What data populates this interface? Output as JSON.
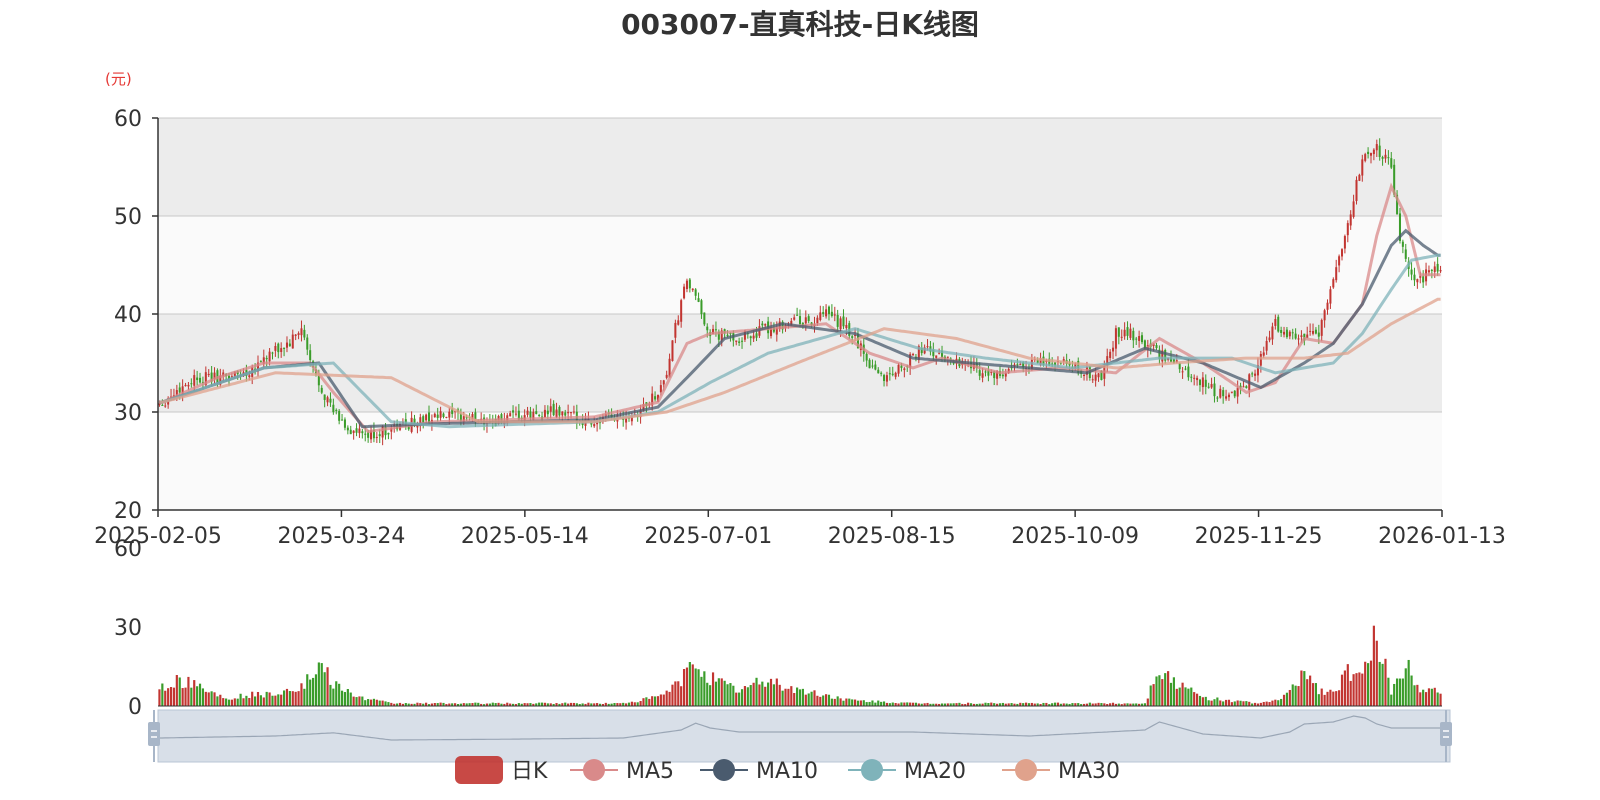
{
  "chart_data": {
    "type": "candlestick",
    "title": "003007-直真科技-日K线图",
    "unit_label": "(元)",
    "price_axis": {
      "ylim": [
        20,
        60
      ],
      "ticks": [
        "20",
        "30",
        "40",
        "50",
        "60"
      ]
    },
    "volume_axis": {
      "ylim": [
        0,
        60
      ],
      "ticks": [
        "0",
        "30",
        "60"
      ]
    },
    "x_ticks": [
      "2025-02-05",
      "2025-03-24",
      "2025-05-14",
      "2025-07-01",
      "2025-08-15",
      "2025-10-09",
      "2025-11-25",
      "2026-01-13"
    ],
    "legend": [
      "日K",
      "MA5",
      "MA10",
      "MA20",
      "MA30"
    ],
    "colors": {
      "up": "#c23531",
      "down": "#3a9c2a",
      "ma5": "#d98a8a",
      "ma10": "#4a5b6e",
      "ma20": "#7fb3ba",
      "ma30": "#e0a28c",
      "grid_band_dark": "#ececec",
      "grid_band_light": "#fafafa",
      "slider_bg": "#d8dfe8"
    },
    "price_path_x": [
      1,
      12,
      20,
      30,
      36,
      45,
      49,
      52,
      55,
      60,
      66,
      72,
      82,
      95,
      105,
      115,
      125,
      135,
      150,
      165,
      172,
      175,
      178,
      182,
      190,
      200,
      210,
      220,
      225,
      230,
      235,
      240,
      245,
      250,
      255,
      260,
      263,
      267,
      270,
      273,
      278,
      285,
      290,
      295,
      300,
      305,
      310,
      315,
      320,
      325,
      330,
      335,
      340,
      345,
      350,
      355,
      360,
      365,
      370,
      375,
      380,
      385,
      390,
      395,
      400,
      405,
      410,
      415,
      420,
      425,
      428,
      431,
      434,
      437,
      440,
      445,
      450,
      455,
      460,
      465,
      470,
      475,
      480,
      485,
      490,
      495,
      500,
      505,
      510,
      515,
      520,
      525,
      530,
      535,
      540,
      545,
      550,
      555,
      560,
      565,
      570,
      575,
      580
    ],
    "price_path_y": [
      31,
      33.5,
      33.5,
      34,
      35.5,
      37,
      38.5,
      35,
      33,
      30,
      28,
      27.5,
      28.5,
      29.5,
      29.5,
      29,
      29.5,
      30,
      29,
      30,
      32,
      34,
      38.5,
      43.5,
      38,
      37.5,
      38.5,
      39.5,
      39,
      40,
      39,
      37.5,
      35,
      33.5,
      34.5,
      35.5,
      36.5,
      36,
      35.5,
      35.5,
      35,
      34,
      33.5,
      34.5,
      35,
      35,
      35,
      34.5,
      34,
      33.5,
      38,
      38,
      37,
      36,
      35,
      34,
      33,
      32,
      31.5,
      33,
      35.5,
      39,
      38,
      37.5,
      38,
      44,
      49,
      56,
      57,
      55,
      47,
      45,
      43,
      44,
      44.5,
      45,
      44.5,
      45,
      45.5,
      45,
      44.5,
      44
    ],
    "series": {
      "MA5": {
        "x": [
          1,
          20,
          36,
          52,
          60,
          72,
          95,
          150,
          172,
          182,
          190,
          210,
          230,
          245,
          260,
          270,
          290,
          310,
          330,
          345,
          360,
          375,
          385,
          395,
          405,
          415,
          420,
          425,
          430,
          435,
          441
        ],
        "y": [
          31,
          33.5,
          35,
          35,
          32,
          28,
          29,
          29.5,
          31,
          37,
          38,
          38.5,
          39,
          36,
          34.5,
          35.5,
          34,
          34.5,
          34,
          37.5,
          35,
          32,
          33,
          37.5,
          37,
          41,
          48,
          53,
          50,
          44,
          44
        ]
      },
      "MA10": {
        "x": [
          1,
          36,
          55,
          70,
          95,
          150,
          172,
          182,
          195,
          215,
          240,
          260,
          280,
          300,
          320,
          340,
          360,
          380,
          395,
          405,
          415,
          425,
          430,
          436,
          441
        ],
        "y": [
          31,
          34.5,
          35,
          28.5,
          28.8,
          29.2,
          30.5,
          33.5,
          37.5,
          39,
          38,
          35.5,
          35,
          34.5,
          34,
          36.5,
          35,
          32.5,
          35,
          37,
          41,
          47,
          48.5,
          47,
          46
        ]
      },
      "MA20": {
        "x": [
          1,
          36,
          60,
          80,
          100,
          150,
          172,
          190,
          210,
          240,
          262,
          285,
          315,
          345,
          370,
          385,
          395,
          405,
          415,
          425,
          432,
          441
        ],
        "y": [
          31,
          34.5,
          35,
          29,
          28.5,
          29,
          30,
          33,
          36,
          38.5,
          36.5,
          35.5,
          34.5,
          35.5,
          35.5,
          34,
          34.5,
          35,
          38,
          42.5,
          45.5,
          46
        ]
      },
      "MA30": {
        "x": [
          1,
          40,
          80,
          110,
          150,
          175,
          195,
          220,
          250,
          275,
          300,
          330,
          350,
          375,
          395,
          410,
          425,
          441
        ],
        "y": [
          31,
          34,
          33.5,
          29,
          29,
          30,
          32,
          35,
          38.5,
          37.5,
          35.5,
          34.5,
          35,
          35.5,
          35.5,
          36,
          39,
          41.5
        ]
      }
    },
    "volume_path_x": [
      1,
      10,
      20,
      25,
      30,
      40,
      50,
      55,
      60,
      65,
      70,
      80,
      85,
      100,
      120,
      140,
      160,
      170,
      175,
      180,
      185,
      190,
      195,
      200,
      210,
      220,
      230,
      240,
      260,
      280,
      300,
      320,
      340,
      345,
      350,
      360,
      380,
      385,
      390,
      395,
      400,
      405,
      410,
      415,
      420,
      425,
      430,
      435,
      441
    ],
    "volume_path_y": [
      8,
      10,
      4,
      3,
      4,
      5,
      8,
      15,
      9,
      5,
      3,
      1,
      1,
      1,
      1,
      1,
      1,
      3,
      5,
      10,
      17,
      11,
      8,
      6,
      10,
      6,
      4,
      2,
      1,
      1,
      1,
      1,
      1,
      15,
      9,
      3,
      1,
      2,
      5,
      14,
      6,
      5,
      13,
      10,
      27,
      5,
      16,
      7,
      6
    ],
    "slider_path_x": [
      0,
      40,
      60,
      80,
      120,
      160,
      180,
      185,
      190,
      200,
      260,
      300,
      340,
      345,
      360,
      380,
      390,
      395,
      405,
      412,
      416,
      420,
      425,
      441
    ],
    "slider_path_y": [
      0.55,
      0.5,
      0.42,
      0.6,
      0.58,
      0.55,
      0.35,
      0.18,
      0.3,
      0.4,
      0.4,
      0.5,
      0.35,
      0.15,
      0.45,
      0.55,
      0.4,
      0.2,
      0.15,
      0.0,
      0.05,
      0.2,
      0.3,
      0.3
    ]
  }
}
